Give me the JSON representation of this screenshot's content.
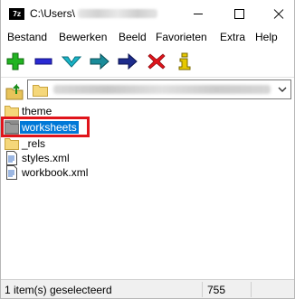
{
  "window": {
    "app_icon_text": "7z",
    "title_prefix": "C:\\Users\\"
  },
  "menu": [
    "Bestand",
    "Bewerken",
    "Beeld",
    "Favorieten",
    "Extra",
    "Help"
  ],
  "toolbar": {
    "icons": [
      "add-icon",
      "extract-icon",
      "test-icon",
      "copy-icon",
      "move-icon",
      "delete-icon",
      "info-icon"
    ],
    "colors": {
      "add": "#22b422",
      "extract": "#2a2ad4",
      "test": "#19b5c8",
      "copy": "#1a8c9a",
      "move": "#1d2c8c",
      "delete": "#e0141b",
      "info": "#e6c800"
    }
  },
  "files": [
    {
      "name": "theme",
      "type": "folder"
    },
    {
      "name": "worksheets",
      "type": "folder",
      "selected": true
    },
    {
      "name": "_rels",
      "type": "folder"
    },
    {
      "name": "styles.xml",
      "type": "file"
    },
    {
      "name": "workbook.xml",
      "type": "file"
    }
  ],
  "status": {
    "selection": "1 item(s) geselecteerd",
    "size": "755"
  },
  "highlight_color": "#e0141b"
}
